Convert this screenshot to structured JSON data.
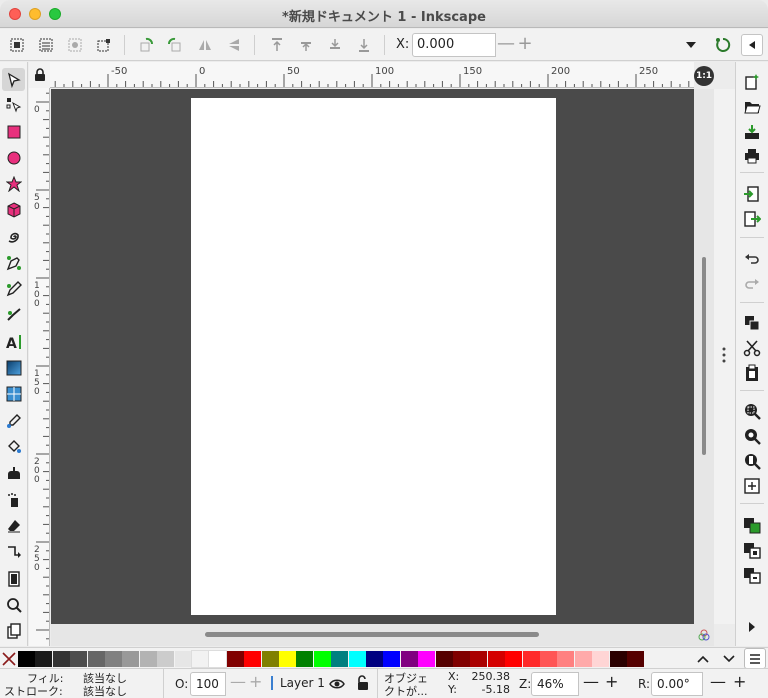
{
  "window": {
    "title": "*新規ドキュメント 1 - Inkscape"
  },
  "toolbar": {
    "x_label": "X:",
    "x_value": "0.000",
    "minus": "—",
    "plus": "+"
  },
  "tools": [
    {
      "name": "selector-tool",
      "icon": "arrow-icon"
    },
    {
      "name": "node-tool",
      "icon": "node-icon"
    },
    {
      "name": "rect-tool",
      "icon": "rectangle-icon"
    },
    {
      "name": "ellipse-tool",
      "icon": "circle-icon"
    },
    {
      "name": "star-tool",
      "icon": "star-icon"
    },
    {
      "name": "3dbox-tool",
      "icon": "cube-icon"
    },
    {
      "name": "spiral-tool",
      "icon": "spiral-icon"
    },
    {
      "name": "pen-tool",
      "icon": "pen-icon"
    },
    {
      "name": "pencil-tool",
      "icon": "pencil-icon"
    },
    {
      "name": "calligraphy-tool",
      "icon": "calligraphy-icon"
    },
    {
      "name": "text-tool",
      "icon": "text-icon"
    },
    {
      "name": "gradient-tool",
      "icon": "gradient-icon"
    },
    {
      "name": "mesh-tool",
      "icon": "mesh-icon"
    },
    {
      "name": "dropper-tool",
      "icon": "dropper-icon"
    },
    {
      "name": "paintbucket-tool",
      "icon": "paint-bucket-icon"
    },
    {
      "name": "tweak-tool",
      "icon": "tweak-icon"
    },
    {
      "name": "spray-tool",
      "icon": "spray-icon"
    },
    {
      "name": "eraser-tool",
      "icon": "eraser-icon"
    },
    {
      "name": "connector-tool",
      "icon": "connector-icon"
    },
    {
      "name": "pages-tool",
      "icon": "page-icon"
    },
    {
      "name": "zoom-tool",
      "icon": "magnifier-icon"
    },
    {
      "name": "measure-tool",
      "icon": "measure-icon"
    }
  ],
  "ruler": {
    "h_labels": [
      "-50",
      "0",
      "50",
      "100",
      "150",
      "200",
      "250"
    ],
    "v_labels": [
      "0",
      "50",
      "100",
      "150",
      "200",
      "250"
    ],
    "zoom_corner": "1:1"
  },
  "palette": {
    "colors": [
      "#000000",
      "#1a1a1a",
      "#333333",
      "#4d4d4d",
      "#666666",
      "#808080",
      "#999999",
      "#b3b3b3",
      "#cccccc",
      "#e6e6e6",
      "#f2f2f2",
      "#ffffff",
      "#800000",
      "#ff0000",
      "#808000",
      "#ffff00",
      "#008000",
      "#00ff00",
      "#008080",
      "#00ffff",
      "#000080",
      "#0000ff",
      "#800080",
      "#ff00ff",
      "#550000",
      "#800000",
      "#aa0000",
      "#d40000",
      "#ff0000",
      "#ff2a2a",
      "#ff5555",
      "#ff8080",
      "#ffaaaa",
      "#ffd5d5",
      "#2b0000",
      "#550000"
    ]
  },
  "status": {
    "fill_label": "フィル:",
    "fill_value": "該当なし",
    "stroke_label": "ストローク:",
    "stroke_value": "該当なし",
    "opacity_label": "O:",
    "opacity_value": "100",
    "layer_name": "Layer 1",
    "object_msg_1": "オブジェ",
    "object_msg_2": "クトが...",
    "x_label": "X:",
    "x_value": "250.38",
    "y_label": "Y:",
    "y_value": "-5.18",
    "zoom_label": "Z:",
    "zoom_value": "46%",
    "rotate_label": "R:",
    "rotate_value": "0.00°",
    "minus": "—",
    "plus": "+"
  }
}
